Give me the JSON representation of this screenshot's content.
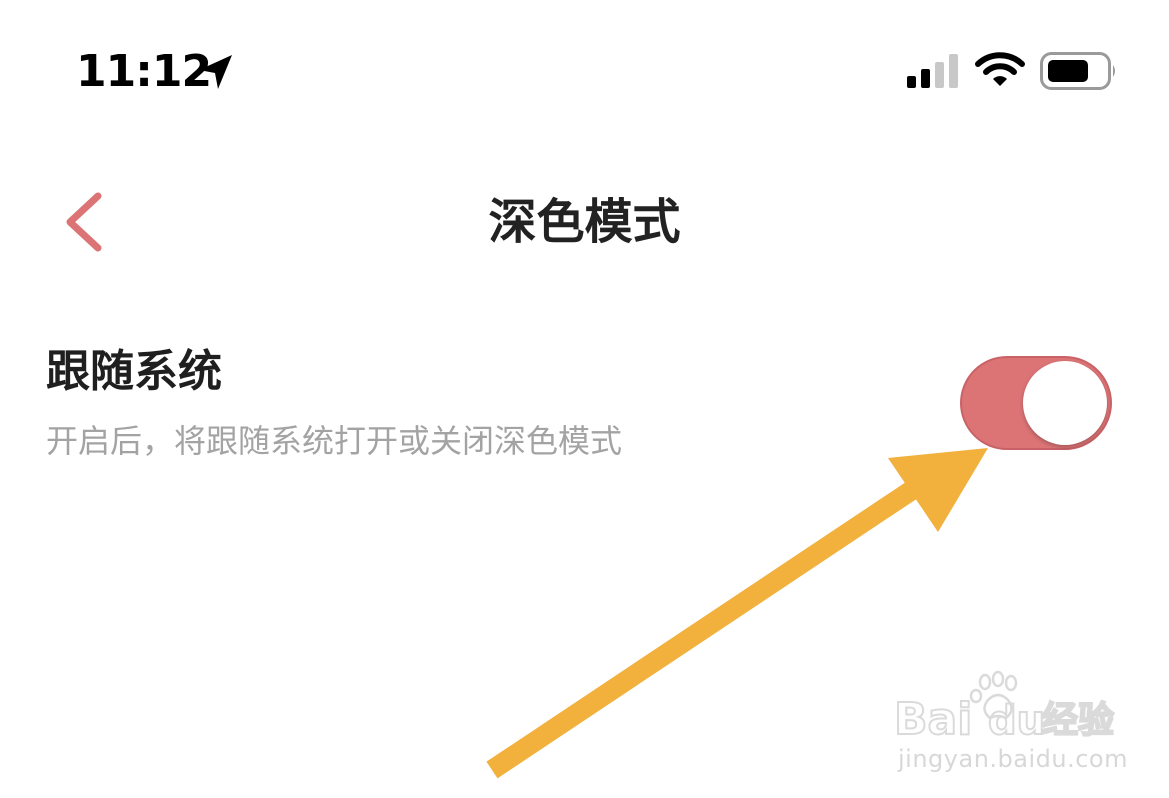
{
  "status_bar": {
    "time": "11:12",
    "location_icon": "location-arrow-icon",
    "signal_icon": "cellular-signal-icon",
    "wifi_icon": "wifi-icon",
    "battery_icon": "battery-icon"
  },
  "nav": {
    "back_icon": "chevron-left-icon",
    "title": "深色模式"
  },
  "setting": {
    "title": "跟随系统",
    "description": "开启后，将跟随系统打开或关闭深色模式",
    "enabled": true
  },
  "watermark": {
    "logo_text": "Bai du 经验",
    "url": "jingyan.baidu.com"
  },
  "colors": {
    "accent": "#dc7476",
    "arrow": "#f2b03c",
    "text_primary": "#1f1f1f",
    "text_secondary": "#a3a3a3"
  }
}
